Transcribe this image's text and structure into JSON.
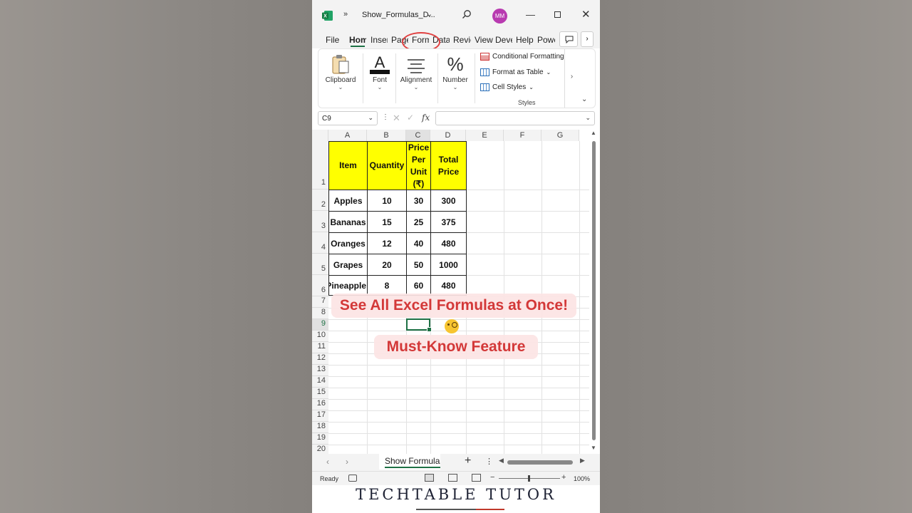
{
  "titlebar": {
    "app_icon": "excel-icon",
    "more": "»",
    "doc_title": "Show_Formulas_D...",
    "avatar_initials": "MM"
  },
  "ribbon_tabs": [
    "File",
    "Hom",
    "Inser",
    "Page",
    "Form",
    "Data",
    "Revie",
    "View",
    "Deve",
    "Help",
    "Powe"
  ],
  "ribbon": {
    "clipboard": "Clipboard",
    "font": "Font",
    "alignment": "Alignment",
    "number": "Number",
    "conditional_formatting": "Conditional Formatting",
    "format_as_table": "Format as Table",
    "cell_styles": "Cell Styles",
    "styles_group": "Styles"
  },
  "formula_bar": {
    "name_box": "C9",
    "fx": "fx",
    "formula": ""
  },
  "grid": {
    "columns": [
      "A",
      "B",
      "C",
      "D",
      "E",
      "F",
      "G"
    ],
    "rows": [
      "1",
      "2",
      "3",
      "4",
      "5",
      "6",
      "7",
      "8",
      "9",
      "10",
      "11",
      "12",
      "13",
      "14",
      "15",
      "16",
      "17",
      "18",
      "19",
      "20"
    ],
    "selected_cell": "C9",
    "table": {
      "headers": [
        "Item",
        "Quantity",
        "Price Per Unit (₹)",
        "Total Price"
      ],
      "rows": [
        [
          "Apples",
          "10",
          "30",
          "300"
        ],
        [
          "Bananas",
          "15",
          "25",
          "375"
        ],
        [
          "Oranges",
          "12",
          "40",
          "480"
        ],
        [
          "Grapes",
          "20",
          "50",
          "1000"
        ],
        [
          "Pineapple",
          "8",
          "60",
          "480"
        ]
      ]
    }
  },
  "overlay": {
    "headline": "See All Excel Formulas at Once!",
    "subline": "Must-Know Feature"
  },
  "sheet_tabs": {
    "active": "Show Formulas"
  },
  "status": {
    "ready": "Ready",
    "zoom": "100%"
  },
  "branding": {
    "text": "TECHTABLE TUTOR"
  },
  "colors": {
    "accent": "#1e7145",
    "highlight": "#ffff00",
    "banner_text": "#d33838",
    "circle": "#e04040"
  }
}
